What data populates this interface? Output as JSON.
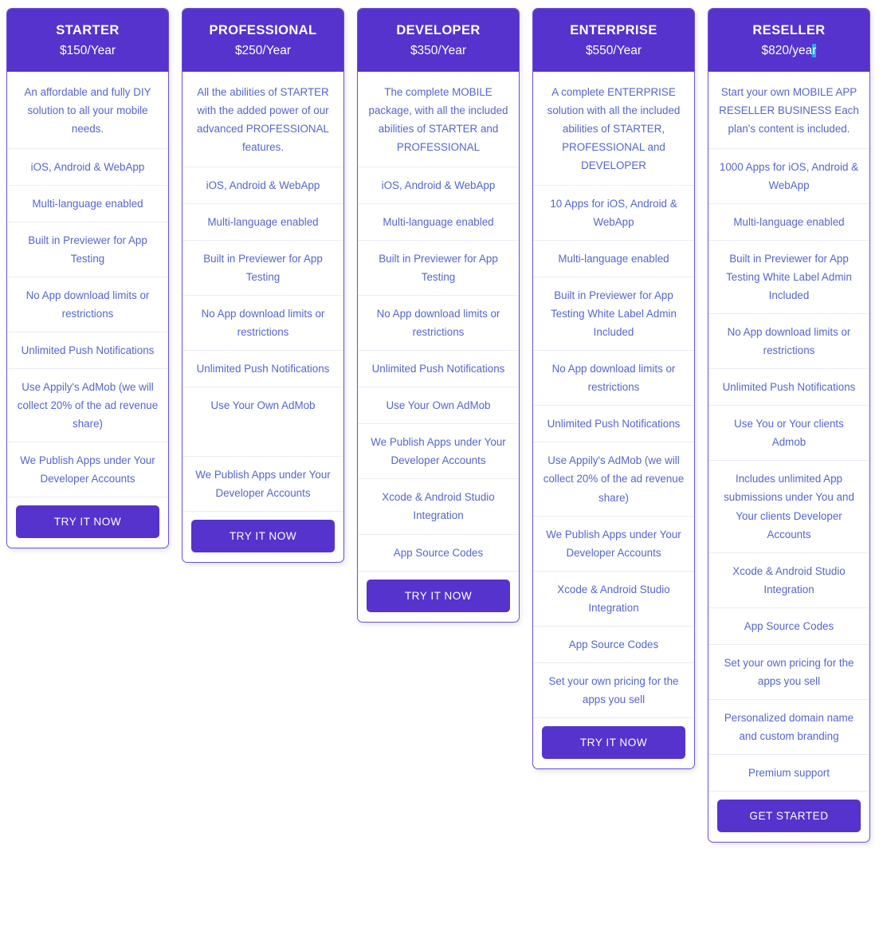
{
  "theme": {
    "accent": "#5533cc",
    "card_border": "#6c4fd8",
    "feature_text": "#5566cc",
    "row_divider": "#eceaf4",
    "selection_highlight": "#2aa3f0",
    "page_background": "#ffffff"
  },
  "plans": [
    {
      "name": "STARTER",
      "price": "$150/Year",
      "price_prefix": "$150/Year",
      "price_selected": "",
      "intro": "An affordable and fully DIY solution to all your mobile needs.",
      "features": [
        "iOS, Android & WebApp",
        "Multi-language enabled",
        "Built in Previewer for App Testing",
        "No App download limits or restrictions",
        "Unlimited Push Notifications",
        "Use Appily's AdMob (we will collect 20% of the ad revenue share)",
        "We Publish Apps under Your Developer Accounts"
      ],
      "cta_label": "TRY IT NOW"
    },
    {
      "name": "PROFESSIONAL",
      "price": "$250/Year",
      "price_prefix": "$250/Year",
      "price_selected": "",
      "intro": "All the abilities of STARTER with the added power of our advanced PROFESSIONAL features.",
      "features": [
        "iOS, Android & WebApp",
        "Multi-language enabled",
        "Built in Previewer for App Testing",
        "No App download limits or restrictions",
        "Unlimited Push Notifications",
        "Use Your Own AdMob",
        "We Publish Apps under Your Developer Accounts"
      ],
      "cta_label": "TRY IT NOW"
    },
    {
      "name": "DEVELOPER",
      "price": "$350/Year",
      "price_prefix": "$350/Year",
      "price_selected": "",
      "intro": "The complete MOBILE package, with all the included abilities of STARTER and PROFESSIONAL",
      "features": [
        "iOS, Android & WebApp",
        "Multi-language enabled",
        "Built in Previewer for App Testing",
        "No App download limits or restrictions",
        "Unlimited Push Notifications",
        "Use Your Own AdMob",
        "We Publish Apps under Your Developer Accounts",
        "Xcode & Android Studio Integration",
        "App Source Codes"
      ],
      "cta_label": "TRY IT NOW"
    },
    {
      "name": "ENTERPRISE",
      "price": "$550/Year",
      "price_prefix": "$550/Year",
      "price_selected": "",
      "intro": "A complete ENTERPRISE solution with all the included abilities of STARTER, PROFESSIONAL and DEVELOPER",
      "features": [
        "10 Apps for iOS, Android & WebApp",
        "Multi-language enabled",
        "Built in Previewer for App Testing White Label Admin Included",
        "No App download limits or restrictions",
        "Unlimited Push Notifications",
        "Use Appily's AdMob (we will collect 20% of the ad revenue share)",
        "We Publish Apps under Your Developer Accounts",
        "Xcode & Android Studio Integration",
        "App Source Codes",
        "Set your own pricing for the apps you sell"
      ],
      "cta_label": "TRY IT NOW"
    },
    {
      "name": "RESELLER",
      "price": "$820/year",
      "price_prefix": "$820/yea",
      "price_selected": "r",
      "intro": "Start your own MOBILE APP RESELLER BUSINESS Each plan's content is included.",
      "features": [
        "1000 Apps for iOS, Android & WebApp",
        "Multi-language enabled",
        "Built in Previewer for App Testing White Label Admin Included",
        "No App download limits or restrictions",
        "Unlimited Push Notifications",
        "Use You or Your clients Admob",
        "Includes unlimited App submissions under You and Your clients Developer Accounts",
        "Xcode & Android Studio Integration",
        "App Source Codes",
        "Set your own pricing for the apps you sell",
        "Personalized domain name and custom branding",
        "Premium support"
      ],
      "cta_label": "GET STARTED"
    }
  ]
}
